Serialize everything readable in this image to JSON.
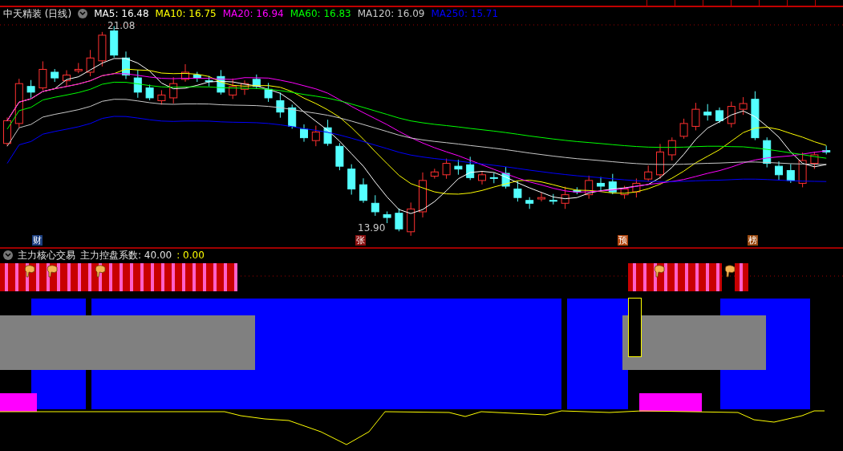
{
  "chart": {
    "title": "中天精装 (日线)",
    "ma": [
      {
        "label": "MA5: 16.48",
        "color": "#ffffff"
      },
      {
        "label": "MA10: 16.75",
        "color": "#ffff00"
      },
      {
        "label": "MA20: 16.94",
        "color": "#ff00ff"
      },
      {
        "label": "MA60: 16.83",
        "color": "#00ff00"
      },
      {
        "label": "MA120: 16.09",
        "color": "#c8c8c8"
      },
      {
        "label": "MA250: 15.71",
        "color": "#0000ff"
      }
    ],
    "high_label": "21.08",
    "low_label": "13.90",
    "markers": [
      {
        "label": "财",
        "color": "#1c3f80"
      },
      {
        "label": "张",
        "color": "#8a0f0f"
      },
      {
        "label": "预",
        "color": "#b4460e"
      },
      {
        "label": "榜",
        "color": "#9c4a10"
      }
    ]
  },
  "indicator": {
    "name": "主力核心交易",
    "coefficient": "主力控盘系数: 40.00",
    "value": ": 0.00"
  }
}
